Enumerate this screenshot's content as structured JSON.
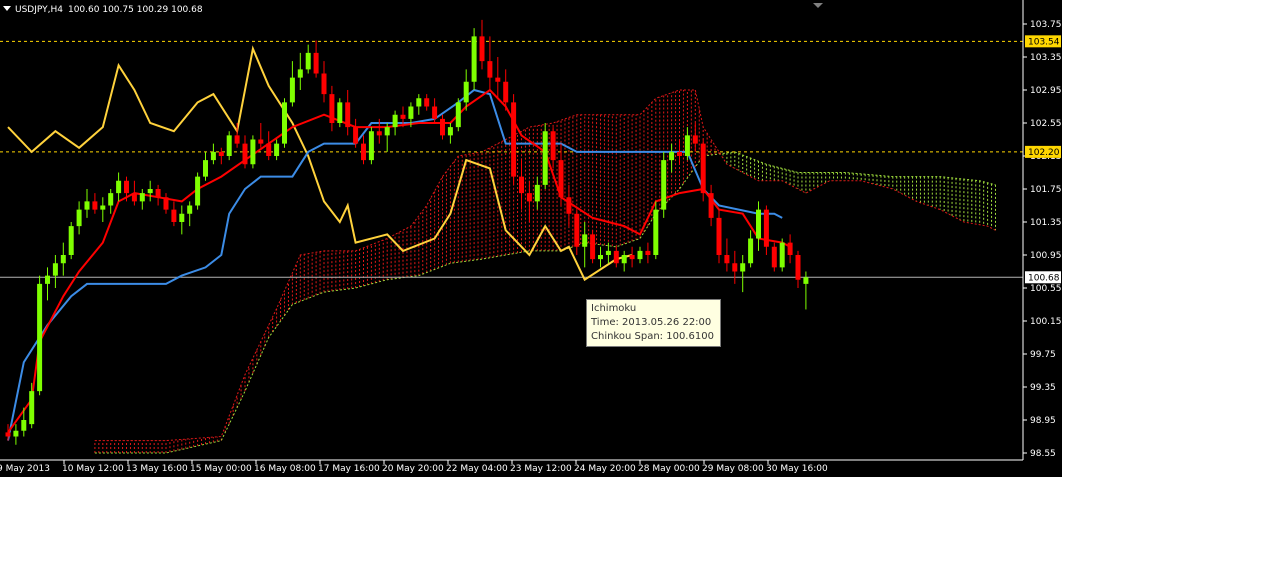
{
  "header": {
    "symbol_timeframe": "USDJPY,H4",
    "open": "100.60",
    "high": "100.75",
    "low": "100.29",
    "close": "100.68"
  },
  "tooltip": {
    "title": "Ichimoku",
    "time": "Time: 2013.05.26 22:00",
    "value": "Chinkou Span: 100.6100"
  },
  "colors": {
    "background": "#000000",
    "bull_candle": "#7fff00",
    "bear_candle": "#ff0000",
    "tenkan": "#ff0000",
    "kijun": "#3c8ce6",
    "chinkou": "#ffd23c",
    "cloud_bear": "#e01818",
    "cloud_bull": "#9fdc3c",
    "span_b": "#c8c83c",
    "axis_text": "#ffffff",
    "price_highlight": "#ffd700"
  },
  "chart_data": {
    "type": "candlestick",
    "symbol": "USDJPY",
    "timeframe": "H4",
    "y_ticks": [
      "103.75",
      "103.35",
      "102.95",
      "102.55",
      "102.15",
      "101.75",
      "101.35",
      "100.95",
      "100.55",
      "100.15",
      "99.75",
      "99.35",
      "98.95",
      "98.55"
    ],
    "ylim": [
      98.5,
      103.9
    ],
    "x_labels": [
      "9 May 2013",
      "10 May 12:00",
      "13 May 16:00",
      "15 May 00:00",
      "16 May 08:00",
      "17 May 16:00",
      "20 May 20:00",
      "22 May 04:00",
      "23 May 12:00",
      "24 May 20:00",
      "28 May 00:00",
      "29 May 08:00",
      "30 May 16:00"
    ],
    "horizontal_lines": [
      {
        "label": "103.54",
        "value": 103.54,
        "style": "dashed"
      },
      {
        "label": "102.20",
        "value": 102.2,
        "style": "dashed"
      },
      {
        "label": "100.68",
        "value": 100.68,
        "style": "solid"
      }
    ],
    "candles": [
      [
        98.8,
        98.9,
        98.7,
        98.75
      ],
      [
        98.75,
        98.9,
        98.65,
        98.82
      ],
      [
        98.82,
        99.1,
        98.75,
        98.95
      ],
      [
        98.9,
        99.4,
        98.85,
        99.3
      ],
      [
        99.3,
        100.7,
        99.25,
        100.6
      ],
      [
        100.6,
        100.8,
        100.4,
        100.7
      ],
      [
        100.7,
        100.95,
        100.55,
        100.85
      ],
      [
        100.85,
        101.1,
        100.7,
        100.95
      ],
      [
        100.95,
        101.35,
        100.9,
        101.3
      ],
      [
        101.3,
        101.6,
        101.2,
        101.5
      ],
      [
        101.5,
        101.75,
        101.4,
        101.6
      ],
      [
        101.6,
        101.7,
        101.45,
        101.5
      ],
      [
        101.5,
        101.65,
        101.35,
        101.55
      ],
      [
        101.55,
        101.75,
        101.45,
        101.7
      ],
      [
        101.7,
        101.95,
        101.6,
        101.85
      ],
      [
        101.85,
        101.9,
        101.6,
        101.7
      ],
      [
        101.7,
        101.85,
        101.55,
        101.6
      ],
      [
        101.6,
        101.75,
        101.5,
        101.7
      ],
      [
        101.7,
        101.85,
        101.6,
        101.75
      ],
      [
        101.75,
        101.8,
        101.55,
        101.65
      ],
      [
        101.65,
        101.7,
        101.45,
        101.5
      ],
      [
        101.5,
        101.6,
        101.3,
        101.35
      ],
      [
        101.35,
        101.55,
        101.2,
        101.45
      ],
      [
        101.45,
        101.6,
        101.3,
        101.55
      ],
      [
        101.55,
        101.95,
        101.5,
        101.9
      ],
      [
        101.9,
        102.2,
        101.85,
        102.1
      ],
      [
        102.1,
        102.3,
        102.05,
        102.2
      ],
      [
        102.2,
        102.25,
        102.05,
        102.15
      ],
      [
        102.15,
        102.45,
        102.1,
        102.4
      ],
      [
        102.4,
        102.55,
        102.25,
        102.3
      ],
      [
        102.3,
        102.4,
        102.0,
        102.05
      ],
      [
        102.05,
        102.4,
        102.0,
        102.35
      ],
      [
        102.35,
        102.55,
        102.25,
        102.3
      ],
      [
        102.3,
        102.45,
        102.1,
        102.15
      ],
      [
        102.15,
        102.35,
        102.1,
        102.3
      ],
      [
        102.3,
        102.85,
        102.25,
        102.8
      ],
      [
        102.8,
        103.3,
        102.75,
        103.1
      ],
      [
        103.1,
        103.4,
        102.95,
        103.2
      ],
      [
        103.2,
        103.5,
        103.15,
        103.4
      ],
      [
        103.4,
        103.55,
        103.1,
        103.15
      ],
      [
        103.15,
        103.3,
        102.8,
        102.9
      ],
      [
        102.9,
        103.0,
        102.45,
        102.55
      ],
      [
        102.55,
        102.85,
        102.5,
        102.8
      ],
      [
        102.8,
        102.95,
        102.4,
        102.5
      ],
      [
        102.5,
        102.6,
        102.25,
        102.3
      ],
      [
        102.3,
        102.4,
        102.05,
        102.1
      ],
      [
        102.1,
        102.5,
        102.05,
        102.45
      ],
      [
        102.45,
        102.6,
        102.3,
        102.4
      ],
      [
        102.4,
        102.55,
        102.2,
        102.5
      ],
      [
        102.5,
        102.7,
        102.4,
        102.65
      ],
      [
        102.65,
        102.75,
        102.5,
        102.6
      ],
      [
        102.6,
        102.8,
        102.5,
        102.75
      ],
      [
        102.75,
        102.9,
        102.65,
        102.85
      ],
      [
        102.85,
        102.9,
        102.7,
        102.75
      ],
      [
        102.75,
        102.85,
        102.55,
        102.6
      ],
      [
        102.6,
        102.65,
        102.35,
        102.4
      ],
      [
        102.4,
        102.55,
        102.3,
        102.5
      ],
      [
        102.5,
        102.85,
        102.45,
        102.8
      ],
      [
        102.8,
        103.2,
        102.7,
        103.05
      ],
      [
        103.05,
        103.7,
        102.95,
        103.6
      ],
      [
        103.6,
        103.8,
        103.2,
        103.3
      ],
      [
        103.3,
        103.6,
        102.95,
        103.1
      ],
      [
        103.1,
        103.35,
        102.85,
        103.05
      ],
      [
        103.05,
        103.2,
        102.7,
        102.8
      ],
      [
        102.8,
        102.9,
        101.8,
        101.9
      ],
      [
        101.9,
        102.1,
        101.5,
        101.7
      ],
      [
        101.7,
        101.85,
        101.35,
        101.6
      ],
      [
        101.6,
        101.9,
        101.5,
        101.8
      ],
      [
        101.8,
        102.55,
        101.75,
        102.45
      ],
      [
        102.45,
        102.5,
        102.0,
        102.1
      ],
      [
        102.1,
        102.3,
        101.55,
        101.65
      ],
      [
        101.65,
        101.8,
        101.3,
        101.45
      ],
      [
        101.45,
        101.5,
        100.95,
        101.05
      ],
      [
        101.05,
        101.35,
        100.8,
        101.2
      ],
      [
        101.2,
        101.25,
        100.85,
        100.9
      ],
      [
        100.9,
        101.05,
        100.8,
        100.95
      ],
      [
        100.95,
        101.1,
        100.85,
        101.0
      ],
      [
        101.0,
        101.05,
        100.8,
        100.85
      ],
      [
        100.85,
        101.0,
        100.75,
        100.95
      ],
      [
        100.95,
        101.05,
        100.8,
        100.9
      ],
      [
        100.9,
        101.05,
        100.85,
        101.0
      ],
      [
        101.0,
        101.1,
        100.85,
        100.95
      ],
      [
        100.95,
        101.6,
        100.9,
        101.5
      ],
      [
        101.5,
        102.2,
        101.4,
        102.1
      ],
      [
        102.1,
        102.3,
        101.95,
        102.2
      ],
      [
        102.2,
        102.35,
        102.05,
        102.15
      ],
      [
        102.15,
        102.5,
        102.1,
        102.4
      ],
      [
        102.4,
        102.55,
        102.2,
        102.3
      ],
      [
        102.3,
        102.35,
        101.6,
        101.7
      ],
      [
        101.7,
        101.8,
        101.3,
        101.4
      ],
      [
        101.4,
        101.5,
        100.85,
        100.95
      ],
      [
        100.95,
        101.15,
        100.75,
        100.85
      ],
      [
        100.85,
        101.0,
        100.6,
        100.75
      ],
      [
        100.75,
        100.95,
        100.5,
        100.85
      ],
      [
        100.85,
        101.25,
        100.8,
        101.15
      ],
      [
        101.15,
        101.6,
        101.0,
        101.5
      ],
      [
        101.5,
        101.55,
        100.95,
        101.05
      ],
      [
        101.05,
        101.1,
        100.75,
        100.8
      ],
      [
        100.8,
        101.15,
        100.75,
        101.1
      ],
      [
        101.1,
        101.2,
        100.85,
        100.95
      ],
      [
        100.95,
        101.0,
        100.55,
        100.65
      ],
      [
        100.6,
        100.75,
        100.29,
        100.68
      ]
    ],
    "tenkan": [
      [
        0,
        98.8
      ],
      [
        3,
        99.2
      ],
      [
        4,
        99.9
      ],
      [
        7,
        100.45
      ],
      [
        9,
        100.75
      ],
      [
        12,
        101.1
      ],
      [
        14,
        101.6
      ],
      [
        16,
        101.7
      ],
      [
        19,
        101.65
      ],
      [
        22,
        101.6
      ],
      [
        24,
        101.75
      ],
      [
        27,
        101.9
      ],
      [
        30,
        102.1
      ],
      [
        33,
        102.3
      ],
      [
        36,
        102.5
      ],
      [
        40,
        102.65
      ],
      [
        44,
        102.5
      ],
      [
        48,
        102.5
      ],
      [
        52,
        102.55
      ],
      [
        56,
        102.55
      ],
      [
        58,
        102.75
      ],
      [
        61,
        102.95
      ],
      [
        63,
        102.75
      ],
      [
        65,
        102.4
      ],
      [
        68,
        102.2
      ],
      [
        70,
        101.65
      ],
      [
        74,
        101.4
      ],
      [
        78,
        101.3
      ],
      [
        80,
        101.2
      ],
      [
        82,
        101.6
      ],
      [
        85,
        101.7
      ],
      [
        88,
        101.75
      ],
      [
        90,
        101.5
      ],
      [
        93,
        101.45
      ],
      [
        95,
        101.15
      ],
      [
        98,
        101.1
      ],
      [
        99,
        101.05
      ]
    ],
    "kijun": [
      [
        0,
        98.7
      ],
      [
        2,
        99.65
      ],
      [
        5,
        100.1
      ],
      [
        8,
        100.45
      ],
      [
        10,
        100.6
      ],
      [
        20,
        100.6
      ],
      [
        22,
        100.7
      ],
      [
        25,
        100.8
      ],
      [
        27,
        100.95
      ],
      [
        28,
        101.45
      ],
      [
        30,
        101.75
      ],
      [
        32,
        101.9
      ],
      [
        36,
        101.9
      ],
      [
        38,
        102.2
      ],
      [
        40,
        102.3
      ],
      [
        44,
        102.3
      ],
      [
        46,
        102.55
      ],
      [
        51,
        102.55
      ],
      [
        54,
        102.6
      ],
      [
        57,
        102.8
      ],
      [
        59,
        102.95
      ],
      [
        61,
        102.9
      ],
      [
        63,
        102.3
      ],
      [
        70,
        102.3
      ],
      [
        72,
        102.2
      ],
      [
        86,
        102.2
      ],
      [
        88,
        101.75
      ],
      [
        90,
        101.55
      ],
      [
        95,
        101.45
      ],
      [
        97,
        101.45
      ],
      [
        98,
        101.4
      ]
    ],
    "chinkou": [
      [
        0,
        102.5
      ],
      [
        3,
        102.2
      ],
      [
        6,
        102.45
      ],
      [
        9,
        102.25
      ],
      [
        12,
        102.5
      ],
      [
        14,
        103.25
      ],
      [
        16,
        102.95
      ],
      [
        18,
        102.55
      ],
      [
        21,
        102.45
      ],
      [
        24,
        102.8
      ],
      [
        26,
        102.9
      ],
      [
        29,
        102.45
      ],
      [
        31,
        103.45
      ],
      [
        33,
        103.0
      ],
      [
        36,
        102.55
      ],
      [
        38,
        102.15
      ],
      [
        40,
        101.6
      ],
      [
        42,
        101.35
      ],
      [
        43,
        101.55
      ],
      [
        44,
        101.1
      ],
      [
        48,
        101.2
      ],
      [
        50,
        101.0
      ],
      [
        54,
        101.15
      ],
      [
        56,
        101.45
      ],
      [
        58,
        102.1
      ],
      [
        61,
        102.0
      ],
      [
        63,
        101.25
      ],
      [
        66,
        100.95
      ],
      [
        68,
        101.3
      ],
      [
        70,
        101.0
      ],
      [
        71,
        101.05
      ],
      [
        73,
        100.65
      ],
      [
        77,
        100.9
      ],
      [
        79,
        100.95
      ]
    ],
    "span_a": [
      [
        11,
        98.55
      ],
      [
        20,
        98.55
      ],
      [
        27,
        98.7
      ],
      [
        30,
        99.3
      ],
      [
        33,
        99.95
      ],
      [
        36,
        100.35
      ],
      [
        40,
        100.5
      ],
      [
        44,
        100.55
      ],
      [
        48,
        100.65
      ],
      [
        52,
        100.7
      ],
      [
        56,
        100.85
      ],
      [
        60,
        100.9
      ],
      [
        63,
        100.95
      ],
      [
        66,
        101.0
      ],
      [
        70,
        101.0
      ],
      [
        73,
        101.1
      ],
      [
        77,
        101.05
      ],
      [
        80,
        101.15
      ],
      [
        82,
        101.45
      ],
      [
        85,
        101.75
      ],
      [
        88,
        102.15
      ],
      [
        92,
        102.2
      ],
      [
        96,
        102.05
      ],
      [
        100,
        101.95
      ],
      [
        106,
        101.95
      ],
      [
        112,
        101.9
      ],
      [
        118,
        101.9
      ],
      [
        123,
        101.85
      ],
      [
        125,
        101.8
      ]
    ],
    "span_b": [
      [
        11,
        98.7
      ],
      [
        20,
        98.7
      ],
      [
        27,
        98.75
      ],
      [
        30,
        99.5
      ],
      [
        34,
        100.3
      ],
      [
        37,
        100.95
      ],
      [
        40,
        101.0
      ],
      [
        44,
        101.0
      ],
      [
        48,
        101.15
      ],
      [
        51,
        101.3
      ],
      [
        53,
        101.55
      ],
      [
        55,
        101.9
      ],
      [
        57,
        102.15
      ],
      [
        60,
        102.2
      ],
      [
        63,
        102.35
      ],
      [
        66,
        102.5
      ],
      [
        69,
        102.55
      ],
      [
        72,
        102.65
      ],
      [
        76,
        102.65
      ],
      [
        80,
        102.65
      ],
      [
        82,
        102.85
      ],
      [
        85,
        102.95
      ],
      [
        87,
        102.95
      ],
      [
        88,
        102.5
      ],
      [
        91,
        102.05
      ],
      [
        95,
        101.85
      ],
      [
        98,
        101.85
      ],
      [
        101,
        101.7
      ],
      [
        104,
        101.85
      ],
      [
        108,
        101.85
      ],
      [
        112,
        101.75
      ],
      [
        115,
        101.6
      ],
      [
        118,
        101.5
      ],
      [
        121,
        101.35
      ],
      [
        124,
        101.3
      ],
      [
        125,
        101.25
      ]
    ]
  }
}
